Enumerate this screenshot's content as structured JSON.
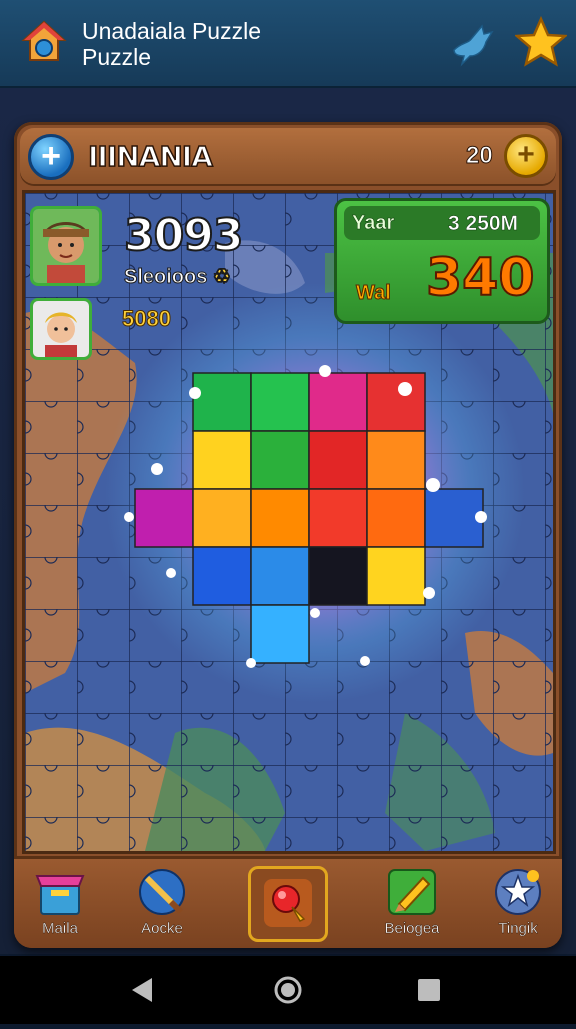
{
  "app": {
    "title": "Unadaiala Puzzle\nPuzzle"
  },
  "header": {
    "level_title": "IIINANIA",
    "coins": "20"
  },
  "stats": {
    "score": "3093",
    "score_label": "Sleoioos",
    "score_label_icon": "♻",
    "secondary_value": "5080"
  },
  "goal": {
    "top_label": "Yaar",
    "top_value": "3 250M",
    "bottom_label": "Wal",
    "bottom_value": "340"
  },
  "toolbar": {
    "items": [
      {
        "label": "Maila",
        "icon": "box-icon"
      },
      {
        "label": "Aocke",
        "icon": "brush-icon"
      },
      {
        "label": "",
        "icon": "hint-bulb-icon"
      },
      {
        "label": "Beiogea",
        "icon": "pencil-icon"
      },
      {
        "label": "Tingik",
        "icon": "gear-star-icon"
      }
    ]
  },
  "colors": {
    "appbar": "#1f4f73",
    "frame": "#8a4f2a",
    "goal_green": "#4cc244",
    "goal_orange": "#ff7a00",
    "accent_gold": "#e2a71f"
  }
}
